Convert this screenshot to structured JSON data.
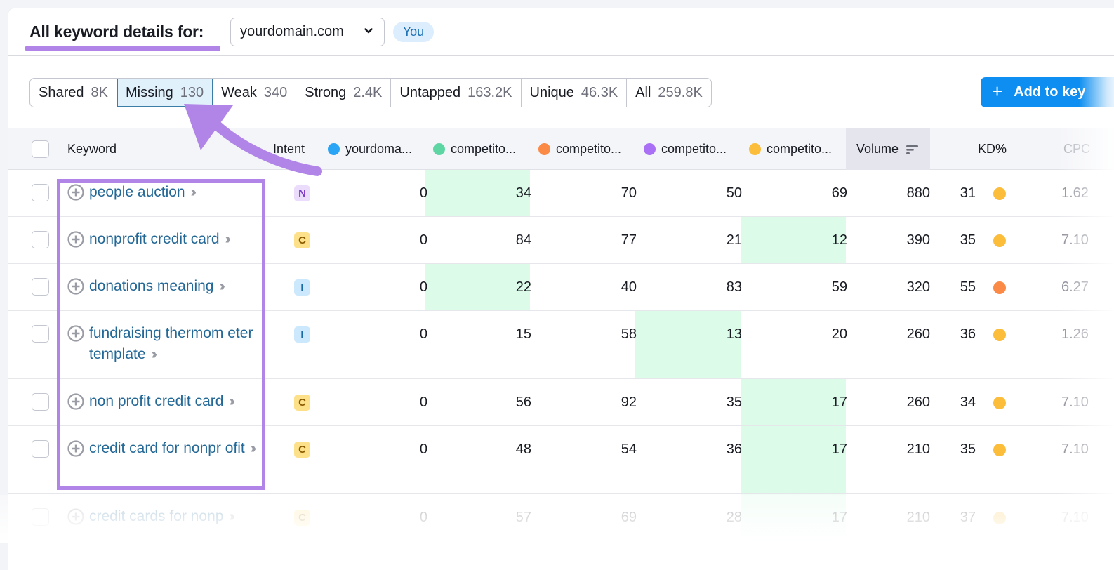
{
  "header": {
    "title": "All keyword details for:",
    "domain_value": "yourdomain.com",
    "you_badge": "You"
  },
  "tabs": [
    {
      "label": "Shared",
      "count": "8K",
      "active": false
    },
    {
      "label": "Missing",
      "count": "130",
      "active": true
    },
    {
      "label": "Weak",
      "count": "340",
      "active": false
    },
    {
      "label": "Strong",
      "count": "2.4K",
      "active": false
    },
    {
      "label": "Untapped",
      "count": "163.2K",
      "active": false
    },
    {
      "label": "Unique",
      "count": "46.3K",
      "active": false
    },
    {
      "label": "All",
      "count": "259.8K",
      "active": false
    }
  ],
  "add_button": {
    "label": "Add to key"
  },
  "table": {
    "columns": {
      "keyword": "Keyword",
      "intent": "Intent",
      "domains": [
        {
          "label": "yourdoma...",
          "color": "#2aa5f6"
        },
        {
          "label": "competito...",
          "color": "#5ed6a4"
        },
        {
          "label": "competito...",
          "color": "#fb8a46"
        },
        {
          "label": "competito...",
          "color": "#a970f5"
        },
        {
          "label": "competito...",
          "color": "#fbbd3a"
        }
      ],
      "volume": "Volume",
      "kd": "KD%",
      "cpc": "CPC"
    },
    "intent_styles": {
      "N": {
        "bg": "#ecdcfb",
        "fg": "#7c3fc7"
      },
      "C": {
        "bg": "#fde18a",
        "fg": "#8a5a00"
      },
      "I": {
        "bg": "#cbe8fc",
        "fg": "#1a6aa5"
      }
    },
    "kd_colors": {
      "yellow": "#fbbd3a",
      "orange": "#fb8a46"
    },
    "rows": [
      {
        "keyword": "people auction",
        "intent": "N",
        "ranks": [
          "0",
          "34",
          "70",
          "50",
          "69"
        ],
        "best": 1,
        "volume": "880",
        "kd": "31",
        "kd_color": "yellow",
        "cpc": "1.62"
      },
      {
        "keyword": "nonprofit credit card",
        "intent": "C",
        "ranks": [
          "0",
          "84",
          "77",
          "21",
          "12"
        ],
        "best": 4,
        "volume": "390",
        "kd": "35",
        "kd_color": "yellow",
        "cpc": "7.10"
      },
      {
        "keyword": "donations meaning",
        "intent": "I",
        "ranks": [
          "0",
          "22",
          "40",
          "83",
          "59"
        ],
        "best": 1,
        "volume": "320",
        "kd": "55",
        "kd_color": "orange",
        "cpc": "6.27"
      },
      {
        "keyword": "fundraising thermom eter template",
        "intent": "I",
        "ranks": [
          "0",
          "15",
          "58",
          "13",
          "20"
        ],
        "best": 3,
        "volume": "260",
        "kd": "36",
        "kd_color": "yellow",
        "cpc": "1.26"
      },
      {
        "keyword": "non profit credit card",
        "intent": "C",
        "ranks": [
          "0",
          "56",
          "92",
          "35",
          "17"
        ],
        "best": 4,
        "volume": "260",
        "kd": "34",
        "kd_color": "yellow",
        "cpc": "7.10"
      },
      {
        "keyword": "credit card for nonpr ofit",
        "intent": "C",
        "ranks": [
          "0",
          "48",
          "54",
          "36",
          "17"
        ],
        "best": 4,
        "volume": "210",
        "kd": "35",
        "kd_color": "yellow",
        "cpc": "7.10"
      },
      {
        "keyword": "credit cards for nonp",
        "intent": "C",
        "ranks": [
          "0",
          "57",
          "69",
          "28",
          "17"
        ],
        "best": 4,
        "volume": "210",
        "kd": "37",
        "kd_color": "yellow",
        "cpc": "7.10"
      }
    ]
  },
  "annotation": {
    "color": "#b184e8"
  }
}
